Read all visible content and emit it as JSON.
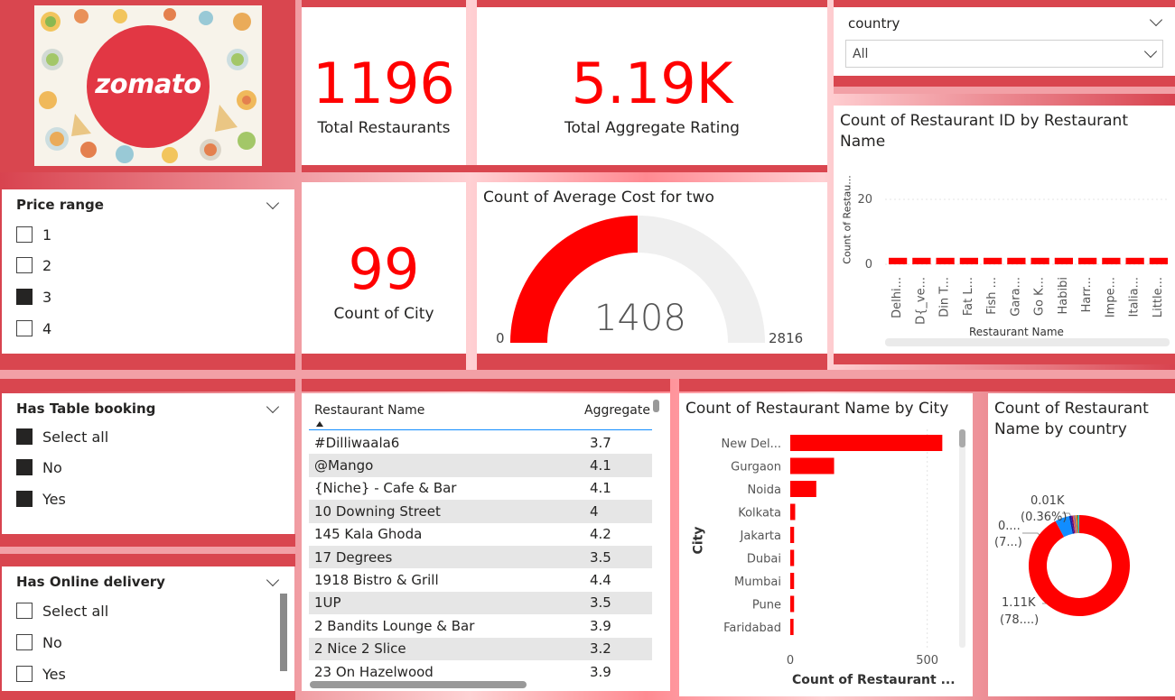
{
  "logo": {
    "text": "zomato",
    "color": "#e23744"
  },
  "kpis": {
    "total_restaurants": {
      "value": "1196",
      "label": "Total Restaurants"
    },
    "total_rating": {
      "value": "5.19K",
      "label": "Total Aggregate Rating"
    },
    "count_city": {
      "value": "99",
      "label": "Count of City"
    }
  },
  "country_slicer": {
    "title": "country",
    "selected": "All"
  },
  "price_slicer": {
    "title": "Price range",
    "options": [
      {
        "label": "1",
        "checked": false
      },
      {
        "label": "2",
        "checked": false
      },
      {
        "label": "3",
        "checked": true
      },
      {
        "label": "4",
        "checked": false
      }
    ]
  },
  "table_booking_slicer": {
    "title": "Has Table booking",
    "options": [
      {
        "label": "Select all",
        "checked": true
      },
      {
        "label": "No",
        "checked": true
      },
      {
        "label": "Yes",
        "checked": true
      }
    ]
  },
  "online_delivery_slicer": {
    "title": "Has Online delivery",
    "options": [
      {
        "label": "Select all",
        "checked": false
      },
      {
        "label": "No",
        "checked": false
      },
      {
        "label": "Yes",
        "checked": false
      }
    ]
  },
  "gauge": {
    "title": "Count of Average Cost for two",
    "value": 1408,
    "min": 0,
    "max": 2816,
    "value_label": "1408",
    "min_label": "0",
    "max_label": "2816"
  },
  "table": {
    "columns": [
      "Restaurant Name",
      "Aggregate"
    ],
    "rows": [
      [
        "#Dilliwaala6",
        "3.7"
      ],
      [
        "@Mango",
        "4.1"
      ],
      [
        "{Niche} - Cafe & Bar",
        "4.1"
      ],
      [
        "10 Downing Street",
        "4"
      ],
      [
        "145 Kala Ghoda",
        "4.2"
      ],
      [
        "17 Degrees",
        "3.5"
      ],
      [
        "1918 Bistro & Grill",
        "4.4"
      ],
      [
        "1UP",
        "3.5"
      ],
      [
        "2 Bandits Lounge & Bar",
        "3.9"
      ],
      [
        "2 Nice 2 Slice",
        "3.2"
      ],
      [
        "23 On Hazelwood",
        "3.9"
      ]
    ]
  },
  "chart_data": [
    {
      "type": "bar",
      "title": "Count of Restaurant ID by Restaurant Name",
      "xlabel": "Restaurant Name",
      "ylabel": "Count of Restau...",
      "categories": [
        "Delhi...",
        "D{_ve...",
        "Din T...",
        "Fat L...",
        "Fish ...",
        "Gara...",
        "Go K...",
        "Habibi",
        "Harr...",
        "Impe...",
        "Italia...",
        "Little..."
      ],
      "values": [
        2,
        2,
        2,
        2,
        2,
        2,
        2,
        2,
        2,
        2,
        2,
        2
      ],
      "yticks": [
        "0",
        "20"
      ],
      "ylim": [
        0,
        20
      ],
      "color": "#ff0000"
    },
    {
      "type": "bar",
      "orientation": "horizontal",
      "title": "Count of Restaurant Name by City",
      "xlabel": "Count of Restaurant ...",
      "ylabel": "City",
      "categories": [
        "New Del...",
        "Gurgaon",
        "Noida",
        "Kolkata",
        "Jakarta",
        "Dubai",
        "Mumbai",
        "Pune",
        "Faridabad"
      ],
      "values": [
        555,
        160,
        95,
        18,
        14,
        14,
        14,
        14,
        12
      ],
      "xticks": [
        "0",
        "500"
      ],
      "xlim": [
        0,
        600
      ],
      "color": "#ff0000"
    },
    {
      "type": "pie",
      "title": "Count of Restaurant Name by country",
      "slices": [
        {
          "value": 1110,
          "color": "#ff0000"
        },
        {
          "value": 55,
          "color": "#118dff"
        },
        {
          "value": 8,
          "color": "#12239e"
        },
        {
          "value": 6,
          "color": "#6b007b"
        },
        {
          "value": 5,
          "color": "#e66c37"
        },
        {
          "value": 5,
          "color": "#744ec2"
        },
        {
          "value": 4,
          "color": "#d9b300"
        },
        {
          "value": 4,
          "color": "#d64550"
        },
        {
          "value": 4,
          "color": "#1aab40"
        },
        {
          "value": 3,
          "color": "#15c6f4"
        }
      ],
      "labels": [
        {
          "line1": "0.01K",
          "line2": "(0.36%)"
        },
        {
          "line1": "0....",
          "line2": "(7...)"
        },
        {
          "line1": "1.11K",
          "line2": "(78....)"
        }
      ]
    }
  ]
}
